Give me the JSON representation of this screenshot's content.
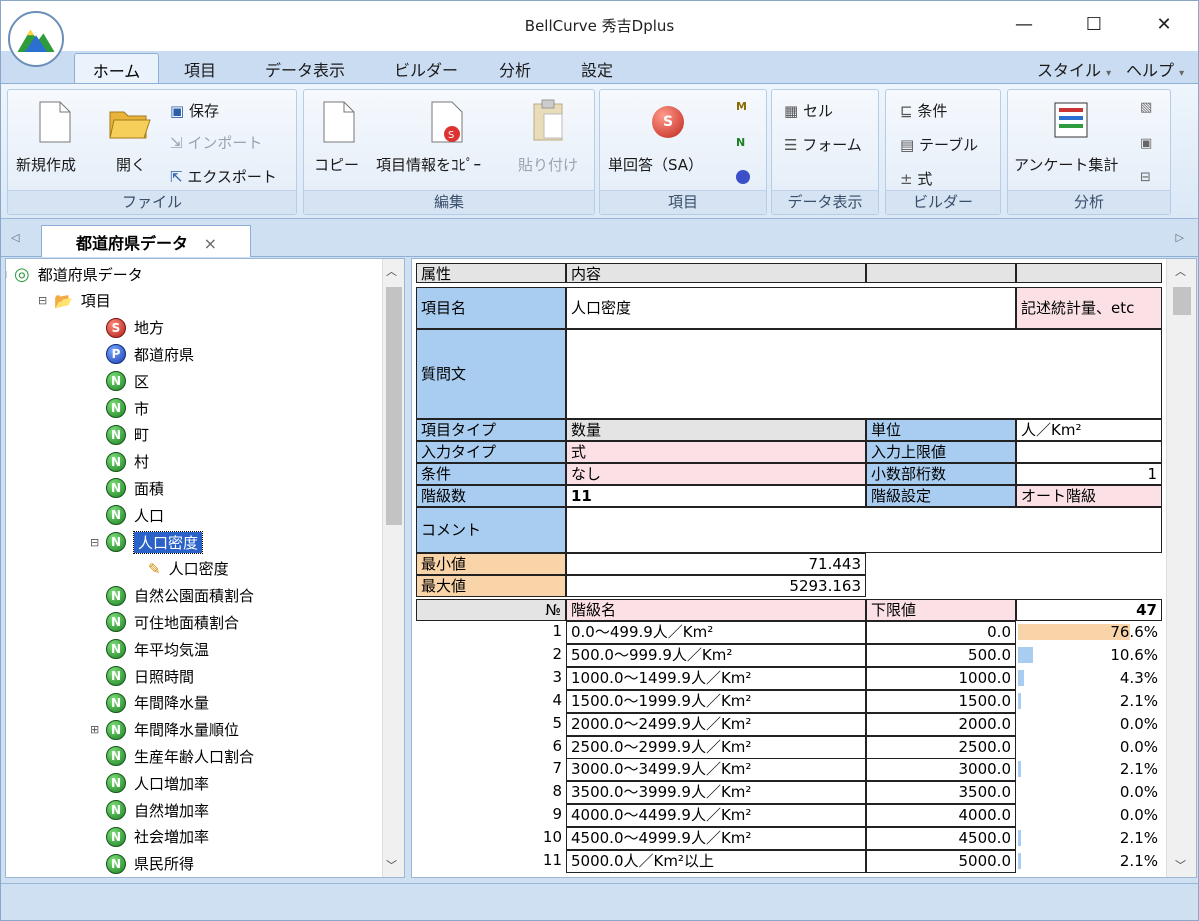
{
  "window": {
    "title": "BellCurve 秀吉Dplus",
    "min": "—",
    "max": "☐",
    "close": "✕"
  },
  "tabs": {
    "home": "ホーム",
    "items": "項目",
    "data_display": "データ表示",
    "builder": "ビルダー",
    "analysis": "分析",
    "settings": "設定",
    "style": "スタイル",
    "help": "ヘルプ"
  },
  "ribbon": {
    "file": {
      "label": "ファイル",
      "new": "新規作成",
      "open": "開く",
      "save": "保存",
      "import": "インポート",
      "export": "エクスポート"
    },
    "edit": {
      "label": "編集",
      "copy": "コピー",
      "copy_item_info": "項目情報をｺﾋﾟｰ",
      "paste": "貼り付け"
    },
    "item": {
      "label": "項目",
      "single_answer": "単回答（SA）"
    },
    "data_display": {
      "label": "データ表示",
      "cell": "セル",
      "form": "フォーム"
    },
    "builder": {
      "label": "ビルダー",
      "condition": "条件",
      "table": "テーブル",
      "formula": "式"
    },
    "analysis": {
      "label": "分析",
      "survey_tally": "アンケート集計"
    }
  },
  "doc_tab": {
    "label": "都道府県データ",
    "close": "×"
  },
  "tree": [
    {
      "text": "都道府県データ",
      "level": 0,
      "icon": "disc",
      "exp": "⊟"
    },
    {
      "text": "項目",
      "level": 1,
      "icon": "folder",
      "exp": "⊟"
    },
    {
      "text": "地方",
      "level": 2,
      "icon": "S"
    },
    {
      "text": "都道府県",
      "level": 2,
      "icon": "P"
    },
    {
      "text": "区",
      "level": 2,
      "icon": "N"
    },
    {
      "text": "市",
      "level": 2,
      "icon": "N"
    },
    {
      "text": "町",
      "level": 2,
      "icon": "N"
    },
    {
      "text": "村",
      "level": 2,
      "icon": "N"
    },
    {
      "text": "面積",
      "level": 2,
      "icon": "N"
    },
    {
      "text": "人口",
      "level": 2,
      "icon": "N"
    },
    {
      "text": "人口密度",
      "level": 2,
      "icon": "N",
      "exp": "⊟",
      "selected": true
    },
    {
      "text": "人口密度",
      "level": 3,
      "icon": "calc"
    },
    {
      "text": "自然公園面積割合",
      "level": 2,
      "icon": "N"
    },
    {
      "text": "可住地面積割合",
      "level": 2,
      "icon": "N"
    },
    {
      "text": "年平均気温",
      "level": 2,
      "icon": "N"
    },
    {
      "text": "日照時間",
      "level": 2,
      "icon": "N"
    },
    {
      "text": "年間降水量",
      "level": 2,
      "icon": "N"
    },
    {
      "text": "年間降水量順位",
      "level": 2,
      "icon": "N",
      "exp": "⊞"
    },
    {
      "text": "生産年齢人口割合",
      "level": 2,
      "icon": "N"
    },
    {
      "text": "人口増加率",
      "level": 2,
      "icon": "N"
    },
    {
      "text": "自然増加率",
      "level": 2,
      "icon": "N"
    },
    {
      "text": "社会増加率",
      "level": 2,
      "icon": "N"
    },
    {
      "text": "県民所得",
      "level": 2,
      "icon": "N"
    }
  ],
  "props": {
    "h_attr": "属性",
    "h_content": "内容",
    "name_label": "項目名",
    "name_value": "人口密度",
    "stats": "記述統計量、etc",
    "question_label": "質問文",
    "type_label": "項目タイプ",
    "type_value": "数量",
    "unit_label": "単位",
    "unit_value": "人／Km²",
    "input_label": "入力タイプ",
    "input_value": "式",
    "upper_label": "入力上限値",
    "upper_value": "",
    "cond_label": "条件",
    "cond_value": "なし",
    "decimal_label": "小数部桁数",
    "decimal_value": "1",
    "classes_label": "階級数",
    "classes_value": "11",
    "class_setting_label": "階級設定",
    "class_setting_value": "オート階級",
    "comment_label": "コメント",
    "min_label": "最小値",
    "min_value": "71.443",
    "max_label": "最大値",
    "max_value": "5293.163",
    "col_no": "№",
    "col_name": "階級名",
    "col_lower": "下限値",
    "total": "47"
  },
  "classes": [
    {
      "no": "1",
      "name": "0.0～499.9人／Km²",
      "lower": "0.0",
      "pct": "76.6%",
      "frac": 0.766
    },
    {
      "no": "2",
      "name": "500.0～999.9人／Km²",
      "lower": "500.0",
      "pct": "10.6%",
      "frac": 0.106
    },
    {
      "no": "3",
      "name": "1000.0～1499.9人／Km²",
      "lower": "1000.0",
      "pct": "4.3%",
      "frac": 0.043
    },
    {
      "no": "4",
      "name": "1500.0～1999.9人／Km²",
      "lower": "1500.0",
      "pct": "2.1%",
      "frac": 0.021
    },
    {
      "no": "5",
      "name": "2000.0～2499.9人／Km²",
      "lower": "2000.0",
      "pct": "0.0%",
      "frac": 0
    },
    {
      "no": "6",
      "name": "2500.0～2999.9人／Km²",
      "lower": "2500.0",
      "pct": "0.0%",
      "frac": 0
    },
    {
      "no": "7",
      "name": "3000.0～3499.9人／Km²",
      "lower": "3000.0",
      "pct": "2.1%",
      "frac": 0.021
    },
    {
      "no": "8",
      "name": "3500.0～3999.9人／Km²",
      "lower": "3500.0",
      "pct": "0.0%",
      "frac": 0
    },
    {
      "no": "9",
      "name": "4000.0～4499.9人／Km²",
      "lower": "4000.0",
      "pct": "0.0%",
      "frac": 0
    },
    {
      "no": "10",
      "name": "4500.0～4999.9人／Km²",
      "lower": "4500.0",
      "pct": "2.1%",
      "frac": 0.021
    },
    {
      "no": "11",
      "name": "5000.0人／Km²以上",
      "lower": "5000.0",
      "pct": "2.1%",
      "frac": 0.021
    }
  ]
}
